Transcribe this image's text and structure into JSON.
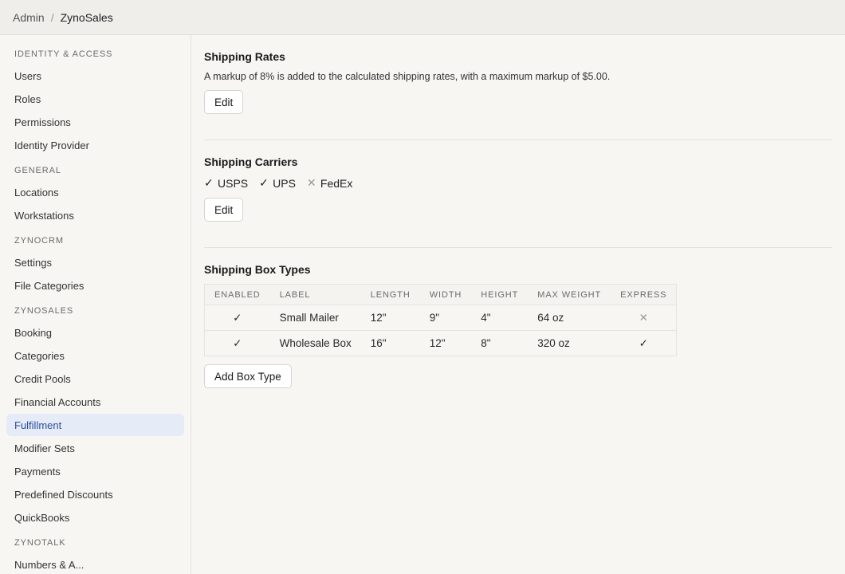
{
  "breadcrumb": {
    "root": "Admin",
    "separator": "/",
    "current": "ZynoSales"
  },
  "sidebar": {
    "sections": [
      {
        "title": "IDENTITY & ACCESS",
        "items": [
          "Users",
          "Roles",
          "Permissions",
          "Identity Provider"
        ]
      },
      {
        "title": "GENERAL",
        "items": [
          "Locations",
          "Workstations"
        ]
      },
      {
        "title": "ZYNOCRM",
        "items": [
          "Settings",
          "File Categories"
        ]
      },
      {
        "title": "ZYNOSALES",
        "items": [
          "Booking",
          "Categories",
          "Credit Pools",
          "Financial Accounts",
          "Fulfillment",
          "Modifier Sets",
          "Payments",
          "Predefined Discounts",
          "QuickBooks"
        ]
      },
      {
        "title": "ZYNOTALK",
        "items": [
          "Numbers & A..."
        ]
      }
    ],
    "active_item": "Fulfillment"
  },
  "shipping_rates": {
    "title": "Shipping Rates",
    "description": "A markup of 8% is added to the calculated shipping rates, with a maximum markup of $5.00.",
    "edit_label": "Edit"
  },
  "shipping_carriers": {
    "title": "Shipping Carriers",
    "carriers": [
      {
        "name": "USPS",
        "enabled": true
      },
      {
        "name": "UPS",
        "enabled": true
      },
      {
        "name": "FedEx",
        "enabled": false
      }
    ],
    "edit_label": "Edit"
  },
  "shipping_box_types": {
    "title": "Shipping Box Types",
    "columns": [
      "ENABLED",
      "LABEL",
      "LENGTH",
      "WIDTH",
      "HEIGHT",
      "MAX WEIGHT",
      "EXPRESS"
    ],
    "rows": [
      {
        "enabled": true,
        "label": "Small Mailer",
        "length": "12\"",
        "width": "9\"",
        "height": "4\"",
        "max_weight": "64 oz",
        "express": false
      },
      {
        "enabled": true,
        "label": "Wholesale Box",
        "length": "16\"",
        "width": "12\"",
        "height": "8\"",
        "max_weight": "320 oz",
        "express": true
      }
    ],
    "add_label": "Add Box Type"
  },
  "icons": {
    "check": "check-icon",
    "cross": "x-icon"
  },
  "colors": {
    "active_bg": "#e5ebf7",
    "active_text": "#2e4f99",
    "disabled_mark": "#999999"
  }
}
